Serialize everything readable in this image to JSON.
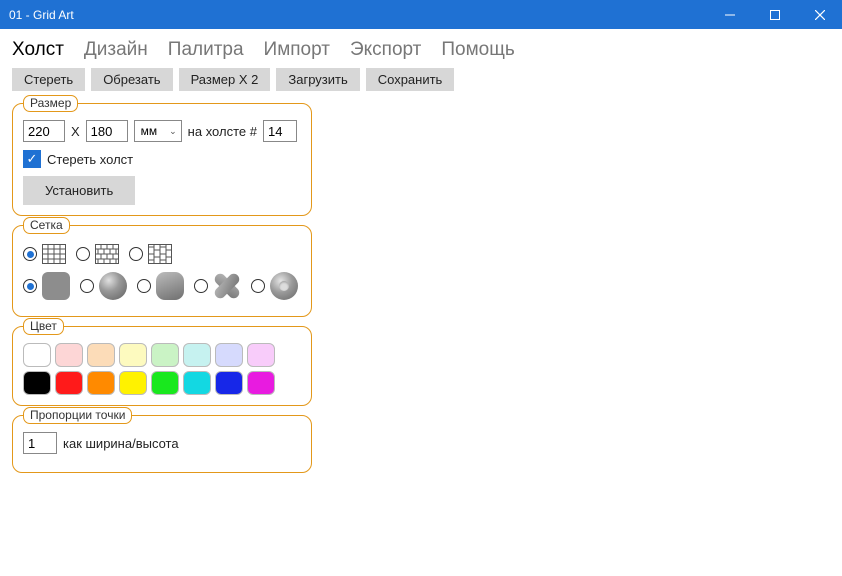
{
  "window": {
    "title": "01 - Grid Art"
  },
  "tabs": [
    "Холст",
    "Дизайн",
    "Палитра",
    "Импорт",
    "Экспорт",
    "Помощь"
  ],
  "activeTab": 0,
  "toolbar": [
    "Стереть",
    "Обрезать",
    "Размер Х 2",
    "Загрузить",
    "Сохранить"
  ],
  "size": {
    "legend": "Размер",
    "width": "220",
    "x": "X",
    "height": "180",
    "unit": "мм",
    "canvasLabel": "на холсте #",
    "canvasNum": "14",
    "eraseLabel": "Стереть холст",
    "eraseChecked": true,
    "setBtn": "Установить"
  },
  "grid": {
    "legend": "Сетка",
    "patternSelected": 0,
    "shapeSelected": 0
  },
  "color": {
    "legend": "Цвет",
    "light": [
      "#ffffff",
      "#fdd6d6",
      "#fcdcb8",
      "#fdfabf",
      "#caf3c5",
      "#c6f2f0",
      "#d6dafd",
      "#f8ccfa"
    ],
    "bright": [
      "#000000",
      "#ff1a1a",
      "#ff8a00",
      "#fff200",
      "#19e81e",
      "#13d8e2",
      "#1727e8",
      "#e81be0"
    ]
  },
  "ratio": {
    "legend": "Пропорции точки",
    "value": "1",
    "label": "как ширина/высота"
  }
}
